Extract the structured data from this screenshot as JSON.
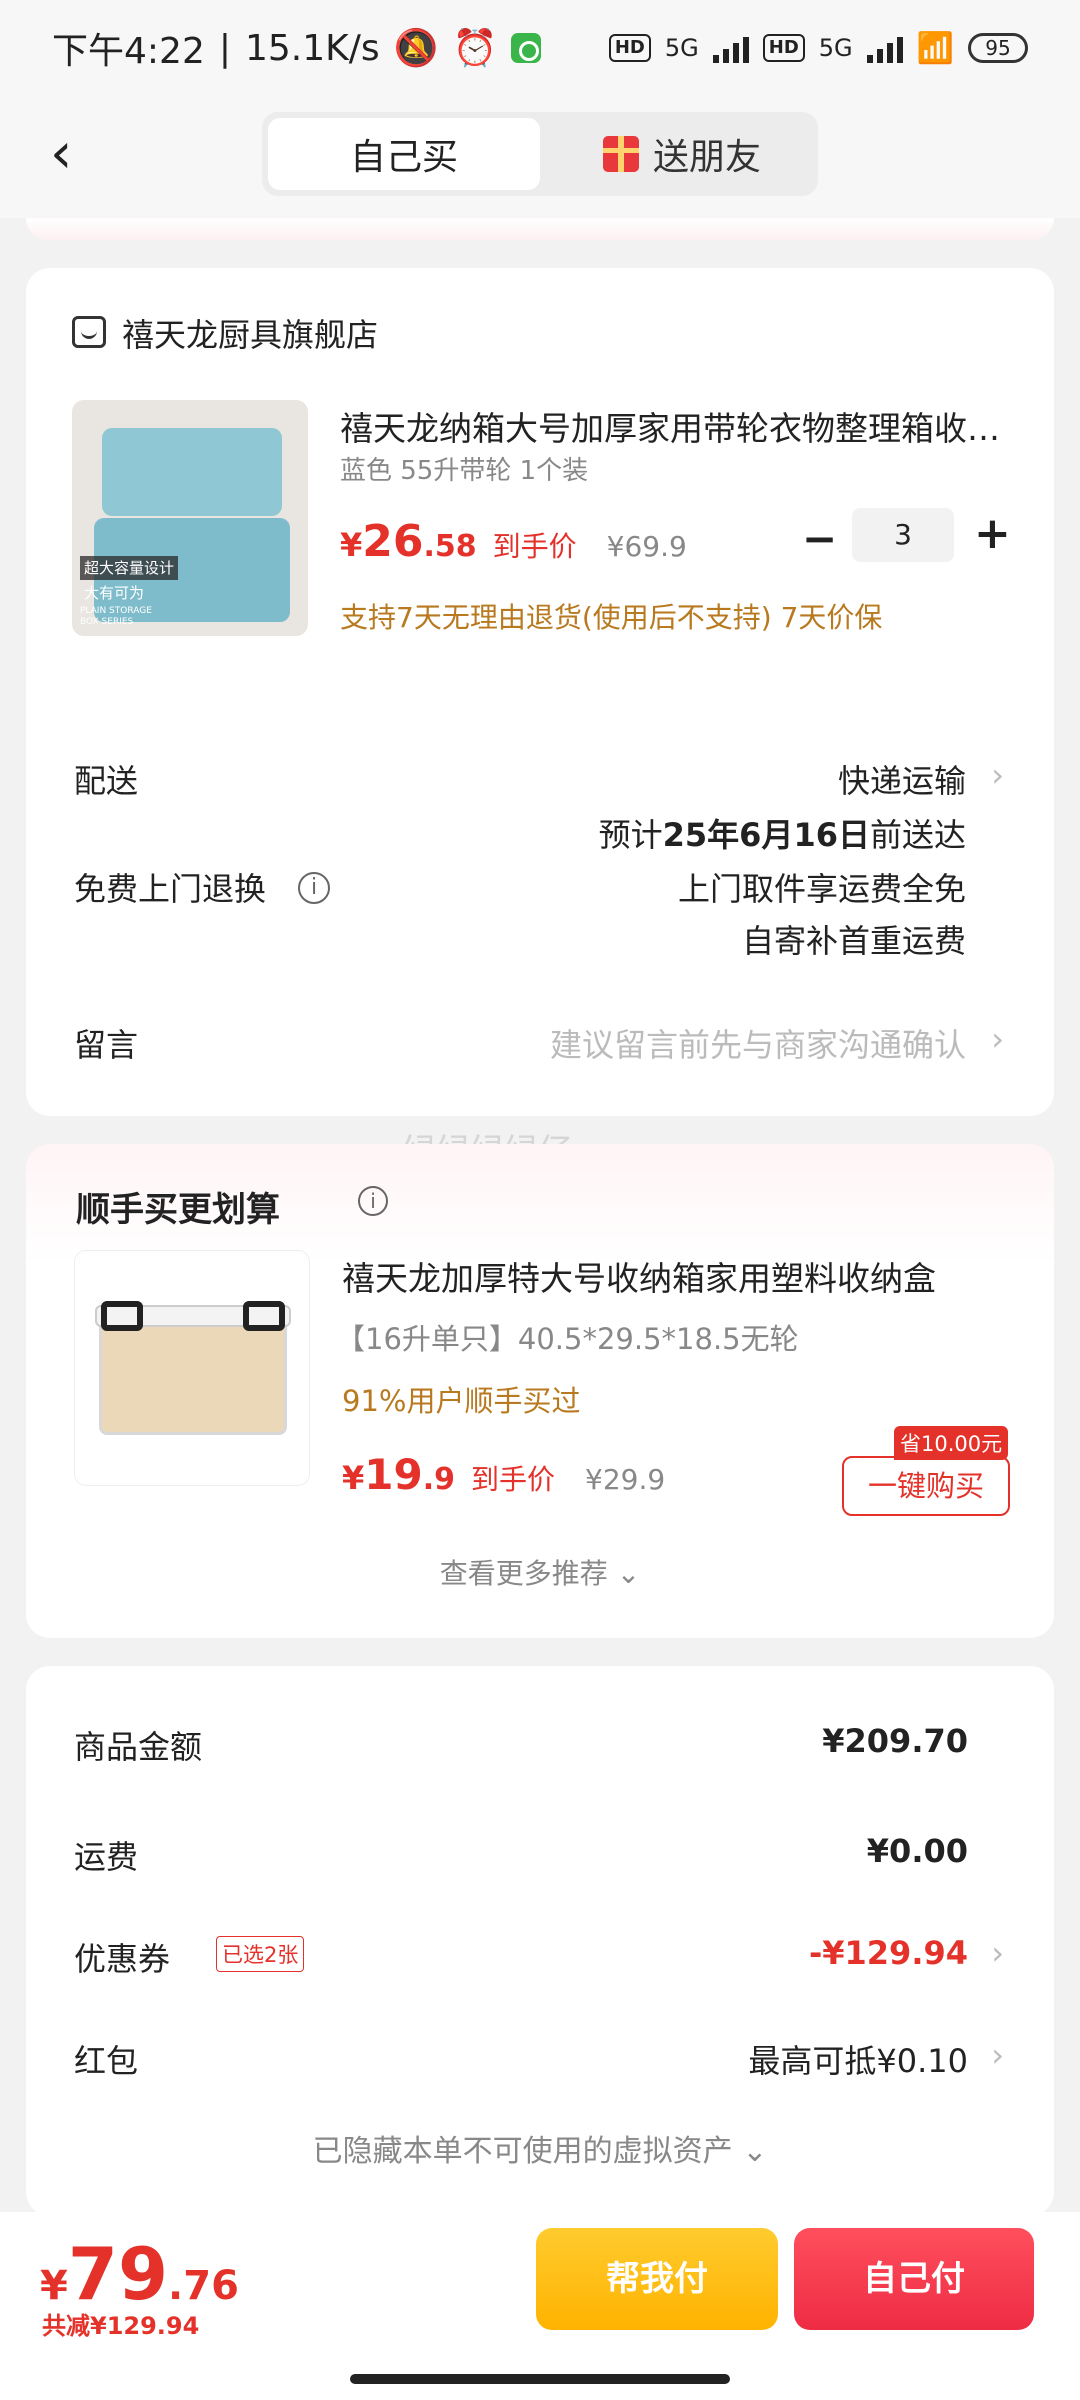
{
  "status_bar": {
    "time": "下午4:22",
    "speed": "15.1K/s",
    "battery": "95",
    "signal1": "HD",
    "signal2": "HD",
    "net1": "5G",
    "net2": "5G"
  },
  "nav": {
    "back_icon": "chevron-left-icon",
    "tab_self": "自己买",
    "tab_gift": "送朋友"
  },
  "order": {
    "store_name": "禧天龙厨具旗舰店",
    "product": {
      "title": "禧天龙纳箱大号加厚家用带轮衣物整理箱收纳箱",
      "spec": "蓝色 55升带轮 1个装",
      "price_yen": "¥",
      "price_int": "26",
      "price_dec": ".58",
      "price_label": "到手价",
      "original_price": "¥69.9",
      "quantity": "3",
      "policy": "支持7天无理由退货(使用后不支持) 7天价保",
      "image_tag1": "超大容量设计",
      "image_tag2": "大有可为",
      "image_tag3": "PLAIN STORAGE BOX SERIES"
    },
    "delivery": {
      "label": "配送",
      "method": "快递运输",
      "eta_prefix": "预计",
      "eta_date": "25年6月16日",
      "eta_suffix": "前送达"
    },
    "returns": {
      "label": "免费上门退换",
      "line1": "上门取件享运费全免",
      "line2": "自寄补首重运费"
    },
    "message": {
      "label": "留言",
      "placeholder": "建议留言前先与商家沟通确认"
    }
  },
  "watermark": "绿绿绿绿仔",
  "recommend": {
    "title": "顺手买更划算",
    "item": {
      "title": "禧天龙加厚特大号收纳箱家用塑料收纳盒",
      "spec": "【16升单只】40.5*29.5*18.5无轮",
      "bought": "91%用户顺手买过",
      "price_yen": "¥",
      "price_int": "19",
      "price_dec": ".9",
      "price_label": "到手价",
      "original_price": "¥29.9",
      "save_tag": "省10.00元",
      "buy_label": "一键购买"
    },
    "more": "查看更多推荐"
  },
  "summary": {
    "goods_label": "商品金额",
    "goods_value": "¥209.70",
    "shipping_label": "运费",
    "shipping_value": "¥0.00",
    "coupon_label": "优惠券",
    "coupon_tag": "已选2张",
    "coupon_value": "-¥129.94",
    "redpacket_label": "红包",
    "redpacket_value": "最高可抵¥0.10",
    "hidden_assets": "已隐藏本单不可使用的虚拟资产"
  },
  "bottom": {
    "total_yen": "¥",
    "total_int": "79",
    "total_dec": ".76",
    "total_reduce": "共减¥129.94",
    "help_pay": "帮我付",
    "self_pay": "自己付"
  },
  "colors": {
    "accent_red": "#e4322b",
    "policy_gold": "#b8791f",
    "help_yellow": "#ffbf1a",
    "pay_red": "#ee2c44"
  }
}
